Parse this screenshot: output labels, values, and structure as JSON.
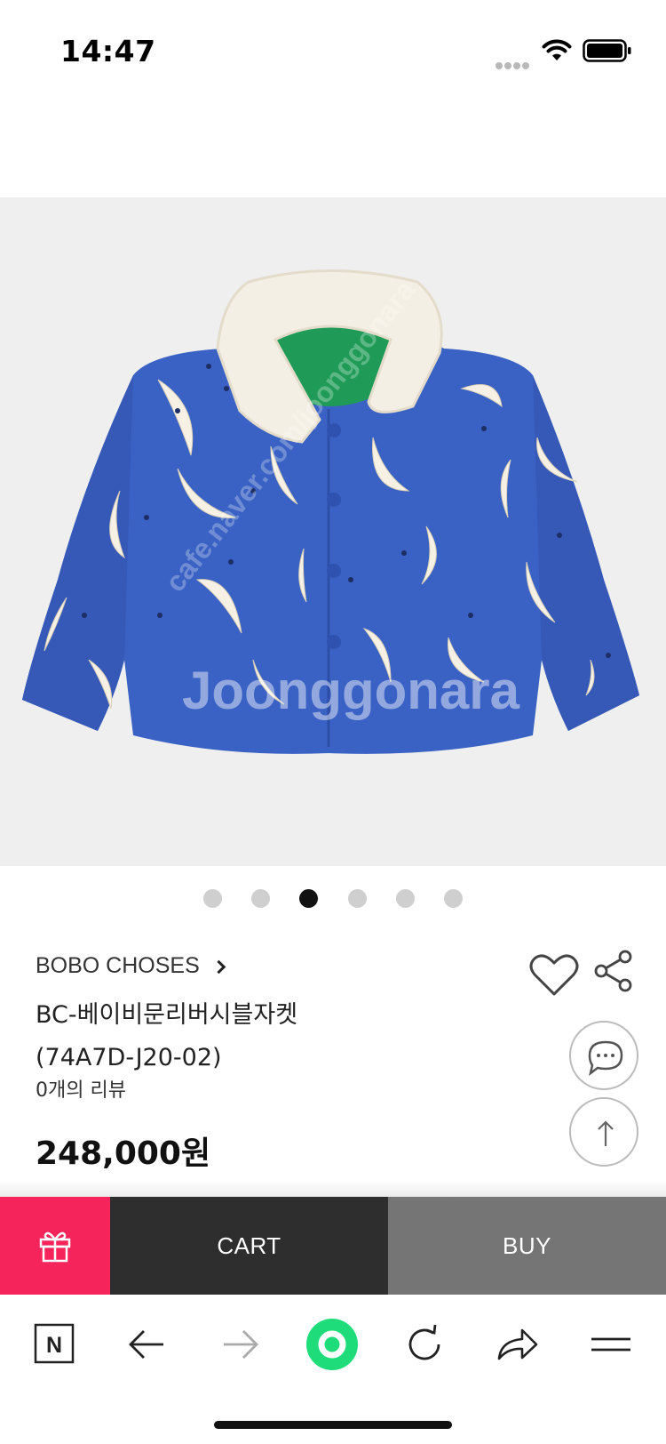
{
  "status_bar": {
    "time": "14:47",
    "signal_icon": "cellular-signal-dots-icon",
    "wifi_icon": "wifi-icon",
    "battery_icon": "battery-full-icon"
  },
  "hero": {
    "image_icon": "product-photo-jacket",
    "watermark_text": "Joonggonara",
    "watermark_side": "cafe.naver.com/joonggonara",
    "carousel": {
      "count": 6,
      "active_index": 2
    }
  },
  "product": {
    "brand": "BOBO CHOSES",
    "name_line1": "BC-베이비문리버시블자켓",
    "name_line2": "(74A7D-J20-02)",
    "review_count": "0개의 리뷰",
    "price": "248,000원"
  },
  "side_actions": {
    "heart_icon": "heart-outline-icon",
    "share_icon": "share-icon",
    "chat_icon": "chat-bubble-icon",
    "top_icon": "arrow-up-icon"
  },
  "action_bar": {
    "gift_icon": "gift-icon",
    "cart_label": "CART",
    "buy_label": "BUY",
    "gift_color": "#f5245a",
    "cart_color": "#2e2e2e",
    "buy_color": "#757575"
  },
  "browser_nav": {
    "items": [
      {
        "icon": "naver-n-icon"
      },
      {
        "icon": "back-arrow-icon"
      },
      {
        "icon": "forward-arrow-icon"
      },
      {
        "icon": "green-home-dot-icon"
      },
      {
        "icon": "refresh-icon"
      },
      {
        "icon": "share-arrow-icon"
      },
      {
        "icon": "menu-icon"
      }
    ],
    "accent": "#1fdc7a"
  }
}
